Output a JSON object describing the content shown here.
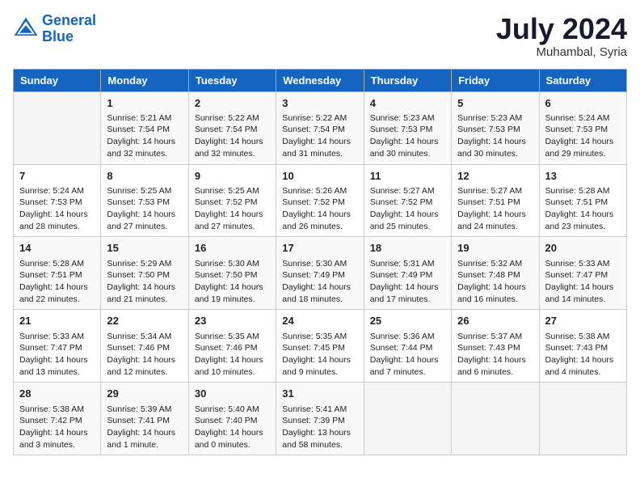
{
  "header": {
    "logo_line1": "General",
    "logo_line2": "Blue",
    "month": "July 2024",
    "location": "Muhambal, Syria"
  },
  "days_of_week": [
    "Sunday",
    "Monday",
    "Tuesday",
    "Wednesday",
    "Thursday",
    "Friday",
    "Saturday"
  ],
  "weeks": [
    [
      {
        "day": "",
        "info": ""
      },
      {
        "day": "1",
        "info": "Sunrise: 5:21 AM\nSunset: 7:54 PM\nDaylight: 14 hours\nand 32 minutes."
      },
      {
        "day": "2",
        "info": "Sunrise: 5:22 AM\nSunset: 7:54 PM\nDaylight: 14 hours\nand 32 minutes."
      },
      {
        "day": "3",
        "info": "Sunrise: 5:22 AM\nSunset: 7:54 PM\nDaylight: 14 hours\nand 31 minutes."
      },
      {
        "day": "4",
        "info": "Sunrise: 5:23 AM\nSunset: 7:53 PM\nDaylight: 14 hours\nand 30 minutes."
      },
      {
        "day": "5",
        "info": "Sunrise: 5:23 AM\nSunset: 7:53 PM\nDaylight: 14 hours\nand 30 minutes."
      },
      {
        "day": "6",
        "info": "Sunrise: 5:24 AM\nSunset: 7:53 PM\nDaylight: 14 hours\nand 29 minutes."
      }
    ],
    [
      {
        "day": "7",
        "info": "Sunrise: 5:24 AM\nSunset: 7:53 PM\nDaylight: 14 hours\nand 28 minutes."
      },
      {
        "day": "8",
        "info": "Sunrise: 5:25 AM\nSunset: 7:53 PM\nDaylight: 14 hours\nand 27 minutes."
      },
      {
        "day": "9",
        "info": "Sunrise: 5:25 AM\nSunset: 7:52 PM\nDaylight: 14 hours\nand 27 minutes."
      },
      {
        "day": "10",
        "info": "Sunrise: 5:26 AM\nSunset: 7:52 PM\nDaylight: 14 hours\nand 26 minutes."
      },
      {
        "day": "11",
        "info": "Sunrise: 5:27 AM\nSunset: 7:52 PM\nDaylight: 14 hours\nand 25 minutes."
      },
      {
        "day": "12",
        "info": "Sunrise: 5:27 AM\nSunset: 7:51 PM\nDaylight: 14 hours\nand 24 minutes."
      },
      {
        "day": "13",
        "info": "Sunrise: 5:28 AM\nSunset: 7:51 PM\nDaylight: 14 hours\nand 23 minutes."
      }
    ],
    [
      {
        "day": "14",
        "info": "Sunrise: 5:28 AM\nSunset: 7:51 PM\nDaylight: 14 hours\nand 22 minutes."
      },
      {
        "day": "15",
        "info": "Sunrise: 5:29 AM\nSunset: 7:50 PM\nDaylight: 14 hours\nand 21 minutes."
      },
      {
        "day": "16",
        "info": "Sunrise: 5:30 AM\nSunset: 7:50 PM\nDaylight: 14 hours\nand 19 minutes."
      },
      {
        "day": "17",
        "info": "Sunrise: 5:30 AM\nSunset: 7:49 PM\nDaylight: 14 hours\nand 18 minutes."
      },
      {
        "day": "18",
        "info": "Sunrise: 5:31 AM\nSunset: 7:49 PM\nDaylight: 14 hours\nand 17 minutes."
      },
      {
        "day": "19",
        "info": "Sunrise: 5:32 AM\nSunset: 7:48 PM\nDaylight: 14 hours\nand 16 minutes."
      },
      {
        "day": "20",
        "info": "Sunrise: 5:33 AM\nSunset: 7:47 PM\nDaylight: 14 hours\nand 14 minutes."
      }
    ],
    [
      {
        "day": "21",
        "info": "Sunrise: 5:33 AM\nSunset: 7:47 PM\nDaylight: 14 hours\nand 13 minutes."
      },
      {
        "day": "22",
        "info": "Sunrise: 5:34 AM\nSunset: 7:46 PM\nDaylight: 14 hours\nand 12 minutes."
      },
      {
        "day": "23",
        "info": "Sunrise: 5:35 AM\nSunset: 7:46 PM\nDaylight: 14 hours\nand 10 minutes."
      },
      {
        "day": "24",
        "info": "Sunrise: 5:35 AM\nSunset: 7:45 PM\nDaylight: 14 hours\nand 9 minutes."
      },
      {
        "day": "25",
        "info": "Sunrise: 5:36 AM\nSunset: 7:44 PM\nDaylight: 14 hours\nand 7 minutes."
      },
      {
        "day": "26",
        "info": "Sunrise: 5:37 AM\nSunset: 7:43 PM\nDaylight: 14 hours\nand 6 minutes."
      },
      {
        "day": "27",
        "info": "Sunrise: 5:38 AM\nSunset: 7:43 PM\nDaylight: 14 hours\nand 4 minutes."
      }
    ],
    [
      {
        "day": "28",
        "info": "Sunrise: 5:38 AM\nSunset: 7:42 PM\nDaylight: 14 hours\nand 3 minutes."
      },
      {
        "day": "29",
        "info": "Sunrise: 5:39 AM\nSunset: 7:41 PM\nDaylight: 14 hours\nand 1 minute."
      },
      {
        "day": "30",
        "info": "Sunrise: 5:40 AM\nSunset: 7:40 PM\nDaylight: 14 hours\nand 0 minutes."
      },
      {
        "day": "31",
        "info": "Sunrise: 5:41 AM\nSunset: 7:39 PM\nDaylight: 13 hours\nand 58 minutes."
      },
      {
        "day": "",
        "info": ""
      },
      {
        "day": "",
        "info": ""
      },
      {
        "day": "",
        "info": ""
      }
    ]
  ]
}
